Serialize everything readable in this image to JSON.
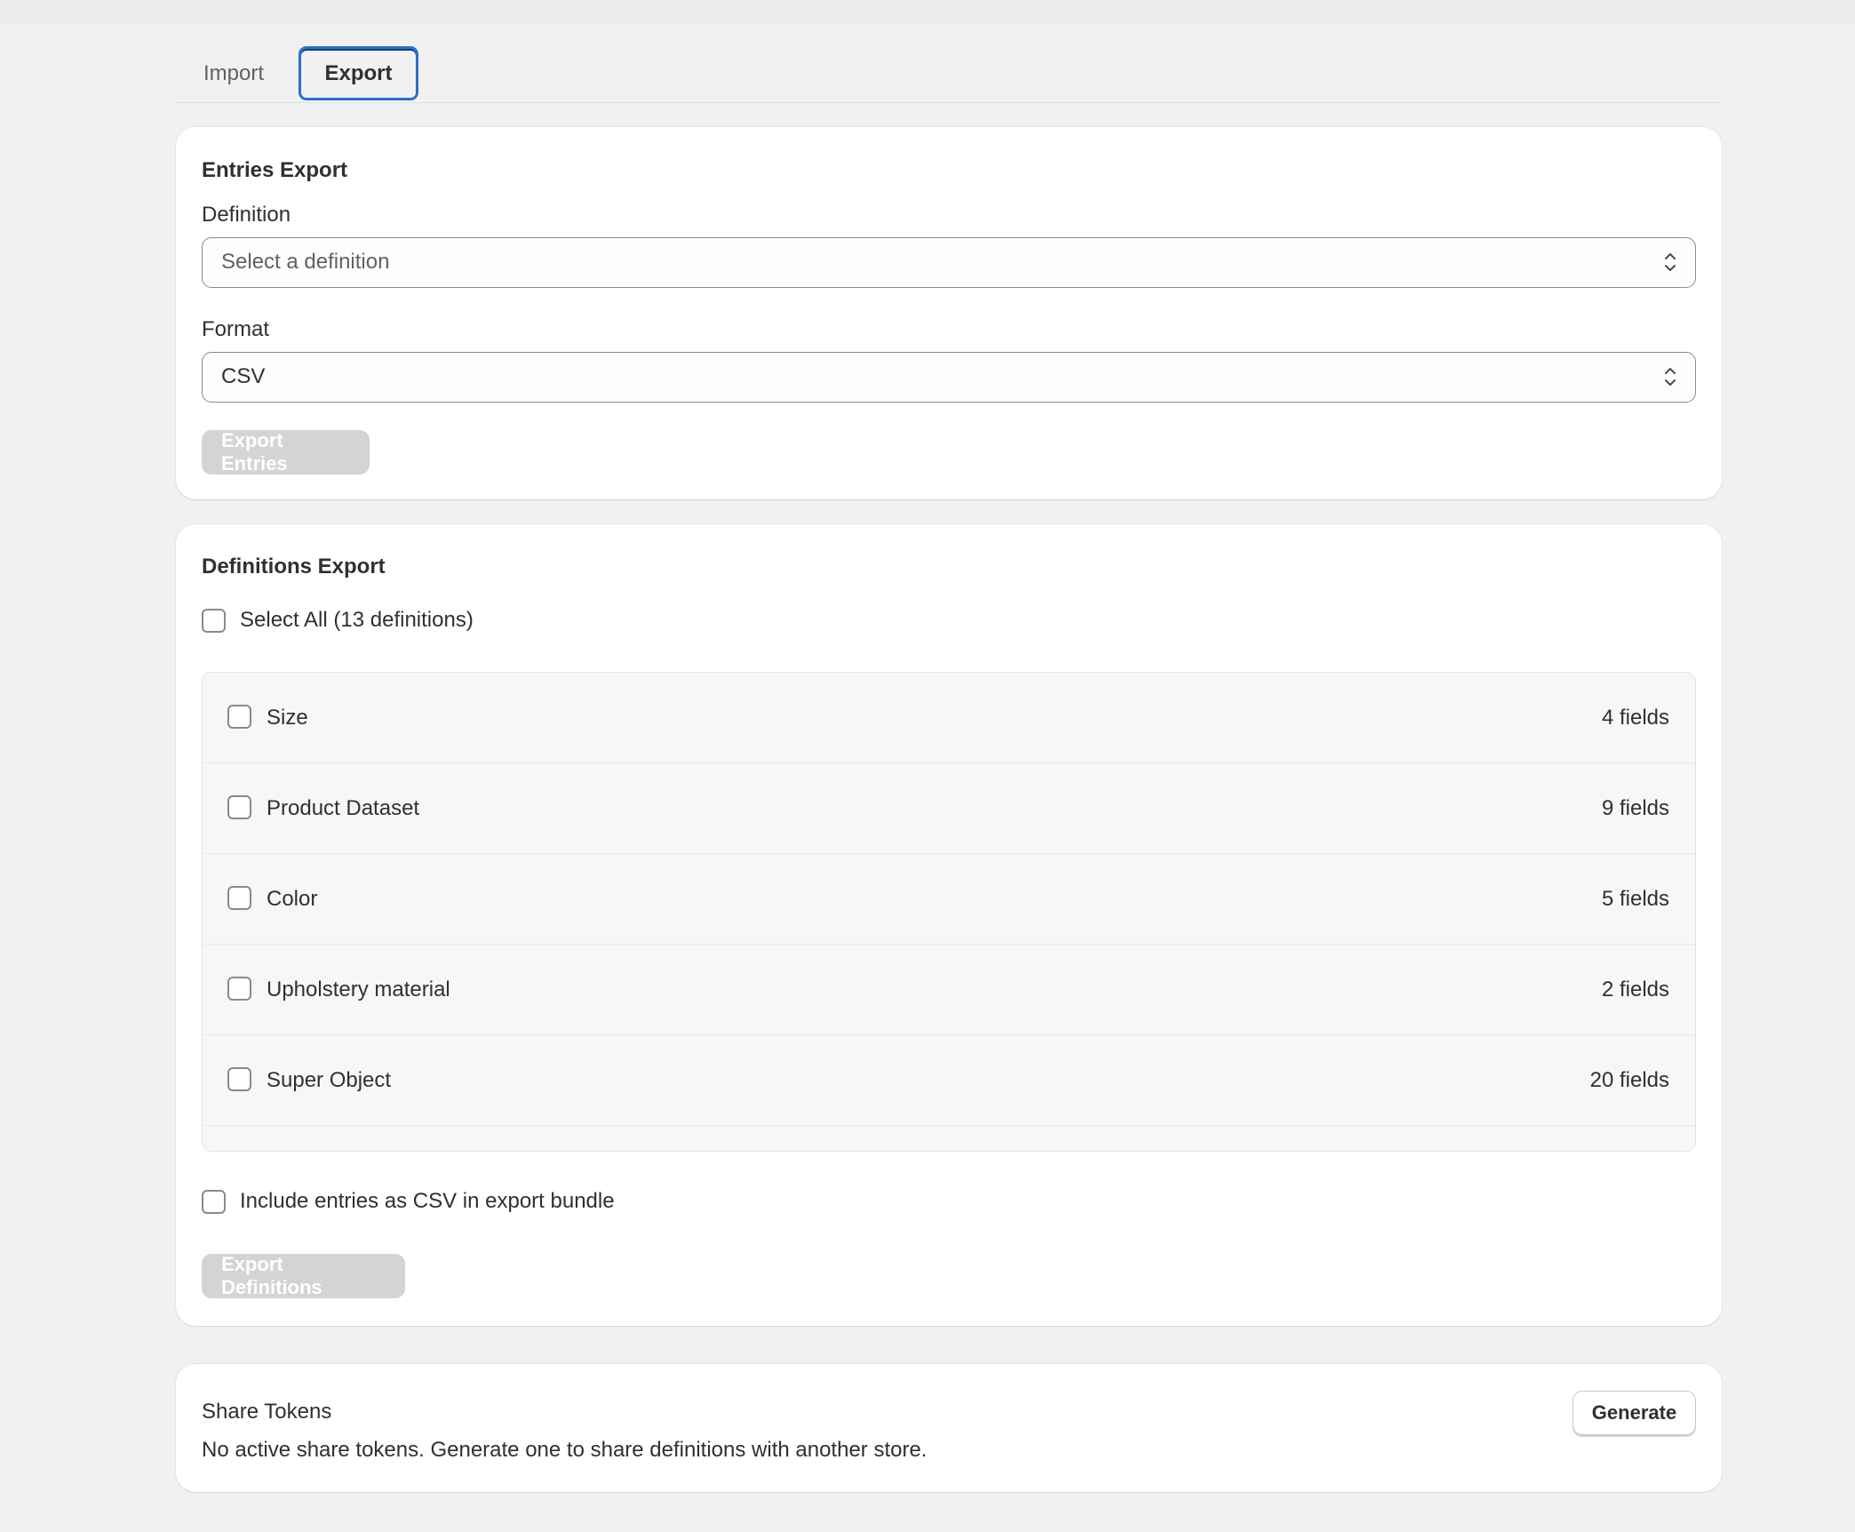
{
  "tabs": {
    "import_label": "Import",
    "export_label": "Export",
    "active": "Export"
  },
  "entries_export": {
    "title": "Entries Export",
    "definition_label": "Definition",
    "definition_placeholder": "Select a definition",
    "format_label": "Format",
    "format_value": "CSV",
    "export_button": "Export Entries"
  },
  "definitions_export": {
    "title": "Definitions Export",
    "select_all_label": "Select All (13 definitions)",
    "select_all_checked": false,
    "items": [
      {
        "name": "Size",
        "count": "4 fields",
        "checked": false
      },
      {
        "name": "Product Dataset",
        "count": "9 fields",
        "checked": false
      },
      {
        "name": "Color",
        "count": "5 fields",
        "checked": false
      },
      {
        "name": "Upholstery material",
        "count": "2 fields",
        "checked": false
      },
      {
        "name": "Super Object",
        "count": "20 fields",
        "checked": false
      }
    ],
    "include_csv_label": "Include entries as CSV in export bundle",
    "include_csv_checked": false,
    "export_button": "Export Definitions"
  },
  "share_tokens": {
    "title": "Share Tokens",
    "description": "No active share tokens. Generate one to share definitions with another store.",
    "generate_button": "Generate"
  },
  "colors": {
    "page_bg": "#f1f1f1",
    "card_bg": "#ffffff",
    "active_tab_border": "#2c6ecb",
    "disabled_button_bg": "#d4d4d4",
    "text": "#303030"
  },
  "icons": {
    "select_chevron": "chevron-up-down-icon",
    "checkbox": "checkbox-unchecked-icon"
  }
}
